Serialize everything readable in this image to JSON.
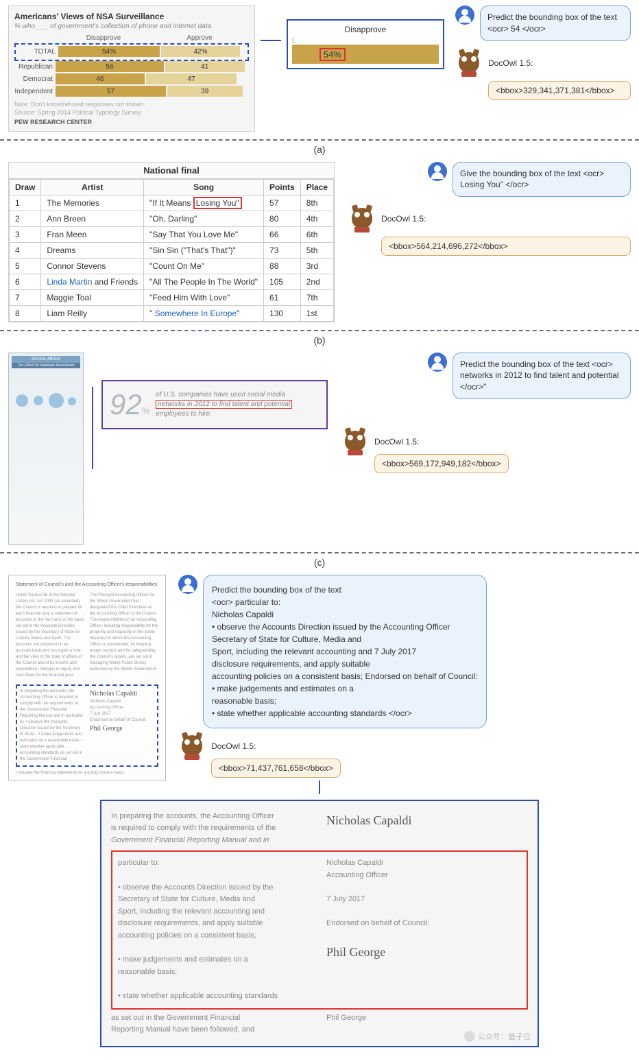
{
  "panel_a": {
    "chart": {
      "title": "Americans' Views of NSA Surveillance",
      "subtitle": "% who ___ of government's collection of phone and internet data",
      "headers": {
        "disapprove": "Disapprove",
        "approve": "Approve"
      },
      "rows": [
        {
          "cat": "TOTAL",
          "dis": "54%",
          "app": "42%"
        },
        {
          "cat": "Republican",
          "dis": "56",
          "app": "41"
        },
        {
          "cat": "Democrat",
          "dis": "46",
          "app": "47"
        },
        {
          "cat": "Independent",
          "dis": "57",
          "app": "39"
        }
      ],
      "note1": "Note: Don't know/refused responses not shown.",
      "note2": "Source: Spring 2014 Political Typology Survey",
      "footer": "PEW RESEARCH CENTER"
    },
    "zoom": {
      "header": "Disapprove",
      "value": "54%"
    },
    "user_prompt": "Predict the bounding box of the text <ocr> 54 </ocr>",
    "model_name": "DocOwl 1.5:",
    "output": "<bbox>329,341,371,381</bbox>"
  },
  "chart_data": {
    "type": "bar",
    "title": "Americans' Views of NSA Surveillance",
    "subtitle": "% who ___ of government's collection of phone and internet data",
    "categories": [
      "TOTAL",
      "Republican",
      "Democrat",
      "Independent"
    ],
    "series": [
      {
        "name": "Disapprove",
        "values": [
          54,
          56,
          46,
          57
        ]
      },
      {
        "name": "Approve",
        "values": [
          42,
          41,
          47,
          39
        ]
      }
    ],
    "xlabel": "",
    "ylabel": "%",
    "ylim": [
      0,
      60
    ],
    "note": "Don't know/refused responses not shown.",
    "source": "Spring 2014 Political Typology Survey — PEW RESEARCH CENTER"
  },
  "label_a": "(a)",
  "panel_b": {
    "table": {
      "title": "National final",
      "headers": [
        "Draw",
        "Artist",
        "Song",
        "Points",
        "Place"
      ],
      "rows": [
        {
          "draw": "1",
          "artist": "The Memories",
          "song_pre": "\"If It Means ",
          "song_hl": "Losing You\"",
          "song_post": "",
          "pts": "57",
          "place": "8th"
        },
        {
          "draw": "2",
          "artist": "Ann Breen",
          "song": "\"Oh, Darling\"",
          "pts": "80",
          "place": "4th"
        },
        {
          "draw": "3",
          "artist": "Fran Meen",
          "song": "\"Say That You Love Me\"",
          "pts": "66",
          "place": "6th"
        },
        {
          "draw": "4",
          "artist": "Dreams",
          "song": "\"Sin Sin (\"That's That\")\"",
          "pts": "73",
          "place": "5th"
        },
        {
          "draw": "5",
          "artist": "Connor Stevens",
          "song": "\"Count On Me\"",
          "pts": "88",
          "place": "3rd"
        },
        {
          "draw": "6",
          "artist_pre": "",
          "artist_link": "Linda Martin",
          "artist_post": " and Friends",
          "song": "\"All The People In The World\"",
          "pts": "105",
          "place": "2nd"
        },
        {
          "draw": "7",
          "artist": "Maggie Toal",
          "song": "\"Feed Him With Love\"",
          "pts": "61",
          "place": "7th"
        },
        {
          "draw": "8",
          "artist": "Liam Reilly",
          "song_pre": "\" ",
          "song_link": "Somewhere In Europe",
          "song_post": "\"",
          "pts": "130",
          "place": "1st"
        }
      ]
    },
    "user_prompt": "Give the bounding box of the text <ocr> Losing You\" </ocr>",
    "model_name": "DocOwl 1.5:",
    "output": "<bbox>564,214,696,272</bbox>"
  },
  "label_b": "(b)",
  "panel_c": {
    "info_title": "SOCIAL MEDIA",
    "info_sub": "The Effect On Employee Recruitment",
    "zoom": {
      "big": "92",
      "pct": "%",
      "line1": "of U.S. companies have used social media",
      "line_hl": "networks in 2012 to find talent and potential",
      "line3": "employees to hire."
    },
    "user_prompt": "Predict the bounding box of the text <ocr> networks in 2012 to find talent and potential </ocr>\"",
    "model_name": "DocOwl 1.5:",
    "output": "<bbox>569,172,949,182</bbox>"
  },
  "label_c": "(c)",
  "panel_d": {
    "doc_head": "Statement of Council's and the Accounting Officer's responsibilities",
    "user_prompt_lines": [
      "Predict the bounding box of the text",
      "<ocr> particular to:",
      "Nicholas Capaldi",
      "• observe the Accounts Direction issued by the Accounting Officer",
      "Secretary of State for Culture, Media and",
      "Sport, including the relevant accounting and 7 July 2017",
      "disclosure requirements, and apply suitable",
      "accounting policies on a consistent basis; Endorsed on behalf of Council:",
      "• make judgements and estimates on a",
      "reasonable basis;",
      "• state whether applicable accounting standards </ocr>"
    ],
    "model_name": "DocOwl 1.5:",
    "output": "<bbox>71,437,761,658</bbox>",
    "zoom": {
      "intro1": "In preparing the accounts, the Accounting Officer",
      "intro2": "is required to comply with the requirements of the",
      "intro3": "Government Financial Reporting Manual and in",
      "left": [
        "particular to:",
        "•  observe the Accounts Direction issued by the",
        "   Secretary of State for Culture, Media and",
        "   Sport, including the relevant accounting and",
        "   disclosure requirements, and apply suitable",
        "   accounting policies on a consistent basis;",
        "•  make judgements and estimates on a",
        "   reasonable basis;",
        "•  state whether applicable accounting standards"
      ],
      "right": [
        "Nicholas Capaldi",
        "Accounting Officer",
        "7 July 2017",
        "Endorsed on behalf of Council:"
      ],
      "sig1": "Nicholas Capaldi",
      "sig2": "Phil George",
      "tail1": "as set out in the Government Financial",
      "tail2": "Reporting Manual have been followed, and",
      "tail_name": "Phil George"
    }
  },
  "watermark": "公众号：量子位"
}
